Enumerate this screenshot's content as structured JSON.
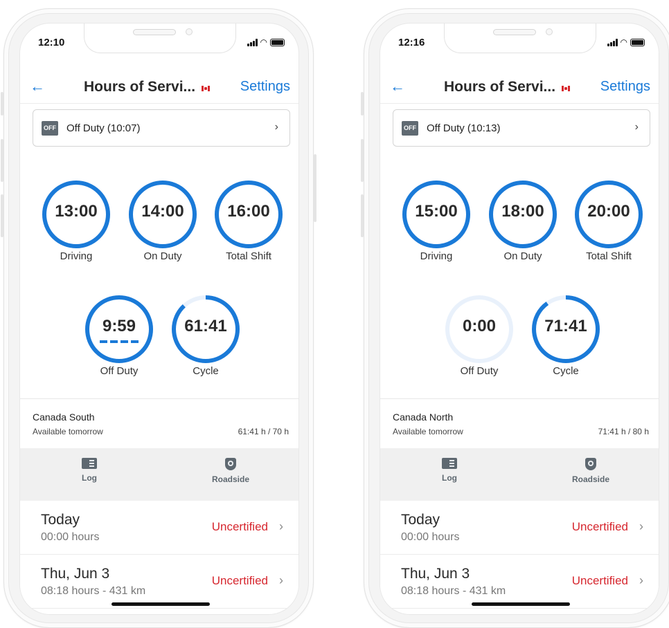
{
  "colors": {
    "accent": "#1a7ad8",
    "uncertified": "#d6262e",
    "ring_track": "#e9f1fb"
  },
  "phones": [
    {
      "status": {
        "time": "12:10"
      },
      "nav": {
        "back": "←",
        "title": "Hours of Servi...",
        "settings": "Settings"
      },
      "duty": {
        "badge": "OFF",
        "label": "Off Duty (10:07)",
        "chevron": "›"
      },
      "clocks": {
        "driving": {
          "value": "13:00",
          "label": "Driving",
          "progress": 1.0
        },
        "on_duty": {
          "value": "14:00",
          "label": "On Duty",
          "progress": 1.0
        },
        "total_shift": {
          "value": "16:00",
          "label": "Total Shift",
          "progress": 1.0
        },
        "off_duty": {
          "value": "9:59",
          "label": "Off Duty",
          "progress": 1.0
        },
        "cycle": {
          "value": "61:41",
          "label": "Cycle",
          "progress": 0.88
        }
      },
      "rule": {
        "name": "Canada South",
        "available": "Available tomorrow",
        "hours": "61:41 h / 70 h"
      },
      "tabs": {
        "log": "Log",
        "roadside": "Roadside"
      },
      "days": [
        {
          "title": "Today",
          "sub": "00:00 hours",
          "status": "Uncertified",
          "chevron": "›"
        },
        {
          "title": "Thu, Jun 3",
          "sub": "08:18 hours - 431 km",
          "status": "Uncertified",
          "chevron": "›"
        }
      ]
    },
    {
      "status": {
        "time": "12:16"
      },
      "nav": {
        "back": "←",
        "title": "Hours of Servi...",
        "settings": "Settings"
      },
      "duty": {
        "badge": "OFF",
        "label": "Off Duty (10:13)",
        "chevron": "›"
      },
      "clocks": {
        "driving": {
          "value": "15:00",
          "label": "Driving",
          "progress": 1.0
        },
        "on_duty": {
          "value": "18:00",
          "label": "On Duty",
          "progress": 1.0
        },
        "total_shift": {
          "value": "20:00",
          "label": "Total Shift",
          "progress": 1.0
        },
        "off_duty": {
          "value": "0:00",
          "label": "Off Duty",
          "progress": 0.0
        },
        "cycle": {
          "value": "71:41",
          "label": "Cycle",
          "progress": 0.9
        }
      },
      "rule": {
        "name": "Canada North",
        "available": "Available tomorrow",
        "hours": "71:41 h / 80 h"
      },
      "tabs": {
        "log": "Log",
        "roadside": "Roadside"
      },
      "days": [
        {
          "title": "Today",
          "sub": "00:00 hours",
          "status": "Uncertified",
          "chevron": "›"
        },
        {
          "title": "Thu, Jun 3",
          "sub": "08:18 hours - 431 km",
          "status": "Uncertified",
          "chevron": "›"
        }
      ]
    }
  ]
}
